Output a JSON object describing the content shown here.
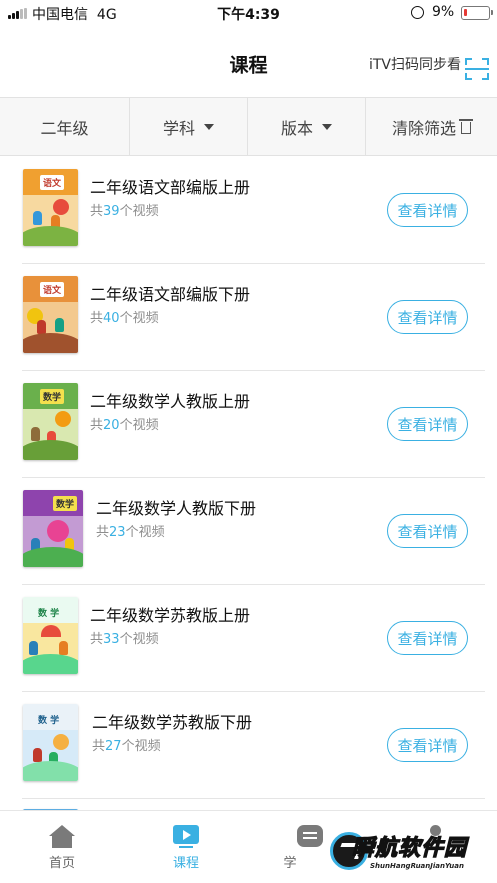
{
  "status_bar": {
    "carrier": "中国电信",
    "network": "4G",
    "time": "下午4:39",
    "battery_percent": "9%",
    "battery_level": 0.09,
    "battery_color": "#e53935"
  },
  "header": {
    "title": "课程",
    "scan_label": "iTV扫码同步看",
    "scan_icon": "scan-icon"
  },
  "filters": {
    "grade": "二年级",
    "subject": "学科",
    "edition": "版本",
    "clear": "清除筛选"
  },
  "courses": [
    {
      "title": "二年级语文部编版上册",
      "count_prefix": "共",
      "count": "39",
      "count_suffix": "个视频",
      "button": "查看详情",
      "cover_word": "语文",
      "cover_color": "#f0a030"
    },
    {
      "title": "二年级语文部编版下册",
      "count_prefix": "共",
      "count": "40",
      "count_suffix": "个视频",
      "button": "查看详情",
      "cover_word": "语文",
      "cover_color": "#e8913a"
    },
    {
      "title": "二年级数学人教版上册",
      "count_prefix": "共",
      "count": "20",
      "count_suffix": "个视频",
      "button": "查看详情",
      "cover_word": "数学",
      "cover_color": "#6ab04c"
    },
    {
      "title": "二年级数学人教版下册",
      "count_prefix": "共",
      "count": "23",
      "count_suffix": "个视频",
      "button": "查看详情",
      "cover_word": "数学",
      "cover_color": "#8e44ad"
    },
    {
      "title": "二年级数学苏教版上册",
      "count_prefix": "共",
      "count": "33",
      "count_suffix": "个视频",
      "button": "查看详情",
      "cover_word": "数 学",
      "cover_color": "#2ecc71"
    },
    {
      "title": "二年级数学苏教版下册",
      "count_prefix": "共",
      "count": "27",
      "count_suffix": "个视频",
      "button": "查看详情",
      "cover_word": "数 学",
      "cover_color": "#5dade2"
    }
  ],
  "tabs": [
    {
      "label": "首页",
      "icon": "home-icon",
      "active": false
    },
    {
      "label": "课程",
      "icon": "course-icon",
      "active": true
    },
    {
      "label": "学",
      "icon": "study-icon",
      "active": false
    },
    {
      "label": "",
      "icon": "profile-icon",
      "active": false
    }
  ],
  "watermark": {
    "cn": "瞬航软件园",
    "en": "ShunHangRuanJianYuan"
  },
  "accent_color": "#3ab0e2"
}
